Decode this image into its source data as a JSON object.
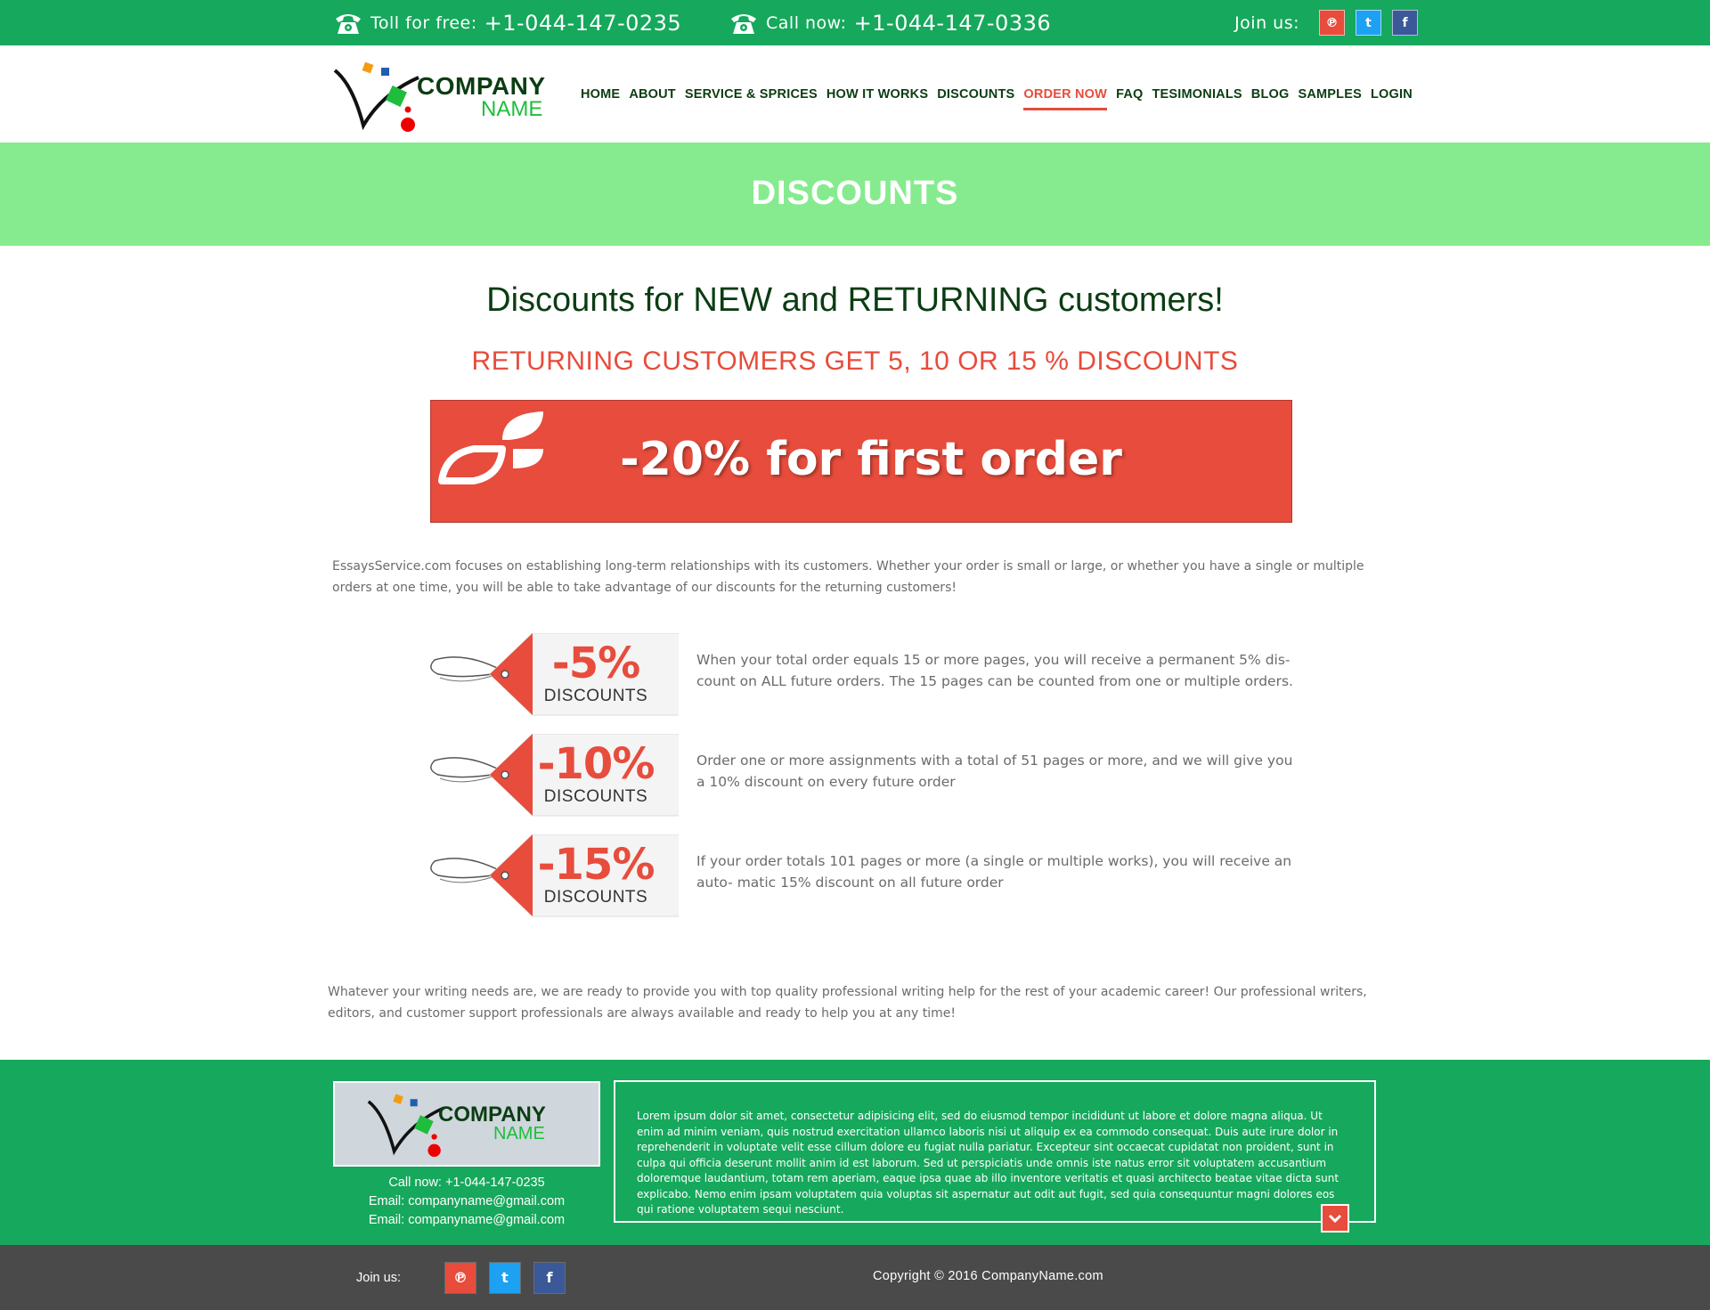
{
  "topbar": {
    "tollfree_label": "Toll for free:",
    "tollfree_number": "+1-044-147-0235",
    "callnow_label": "Call now:",
    "callnow_number": "+1-044-147-0336",
    "join_label": "Join us:",
    "social": [
      {
        "name": "pinterest-icon",
        "glyph": "℗",
        "color": "#e74c3c"
      },
      {
        "name": "twitter-icon",
        "glyph": "t",
        "color": "#1da1f2"
      },
      {
        "name": "facebook-icon",
        "glyph": "f",
        "color": "#3b5998"
      }
    ]
  },
  "logo": {
    "line1": "COMPANY",
    "line2": "NAME"
  },
  "nav": {
    "items": [
      {
        "label": "HOME"
      },
      {
        "label": "ABOUT"
      },
      {
        "label": "SERVICE & SPRICES"
      },
      {
        "label": "HOW IT WORKS"
      },
      {
        "label": "DISCOUNTS"
      },
      {
        "label": "ORDER NOW",
        "active": true
      },
      {
        "label": "FAQ"
      },
      {
        "label": "TESIMONIALS"
      },
      {
        "label": "BLOG"
      },
      {
        "label": "SAMPLES"
      },
      {
        "label": "LOGIN"
      }
    ]
  },
  "banner": {
    "title": "DISCOUNTS"
  },
  "main": {
    "heading": "Discounts for NEW and RETURNING customers!",
    "subheading": "RETURNING CUSTOMERS GET 5, 10 OR 15 % DISCOUNTS",
    "promo": "-20% for first order",
    "intro": "EssaysService.com focuses on establishing long-term relationships with its customers.  Whether your order is small or large, or whether you have a single or multiple orders at one time, you will be able to take advantage of our discounts for the returning customers!",
    "discounts": [
      {
        "percent": "-5%",
        "label": "DISCOUNTS",
        "text": "When your total order equals 15 or more pages, you will receive a permanent 5% dis- count on ALL future orders. The 15 pages can be counted from one or multiple orders."
      },
      {
        "percent": "-10%",
        "label": "DISCOUNTS",
        "text": "Order one or more assignments with a total of 51 pages or more, and we will give you a 10% discount on every future order"
      },
      {
        "percent": "-15%",
        "label": "DISCOUNTS",
        "text": "If your order totals 101 pages or more (a single or multiple works), you will receive an auto- matic 15% discount on all future order"
      }
    ],
    "outro": "Whatever your writing needs are, we are ready to provide you with top quality professional writing help for the rest of your academic career!  Our professional writers, editors, and customer support professionals are always available and ready to help you at any time!"
  },
  "footer": {
    "logo": {
      "line1": "COMPANY",
      "line2": "NAME"
    },
    "call": "Call now: +1-044-147-0235",
    "email1": "Email: companyname@gmail.com",
    "email2": "Email: companyname@gmail.com",
    "lorem": "Lorem ipsum dolor sit amet, consectetur adipisicing elit, sed do eiusmod tempor incididunt ut labore et dolore magna aliqua. Ut enim ad minim veniam, quis nostrud exercitation ullamco laboris nisi ut aliquip ex ea commodo consequat. Duis aute irure dolor in reprehenderit in voluptate velit esse cillum dolore eu fugiat nulla pariatur. Excepteur sint occaecat cupidatat non proident, sunt in culpa qui officia deserunt mollit anim id est laborum. Sed ut perspiciatis unde omnis iste natus error sit voluptatem accusantium doloremque laudantium, totam rem aperiam, eaque ipsa quae ab illo inventore veritatis et quasi architecto beatae vitae dicta sunt explicabo. Nemo enim ipsam voluptatem quia voluptas sit aspernatur aut odit aut fugit, sed quia consequuntur magni dolores eos qui ratione voluptatem sequi nesciunt."
  },
  "bottombar": {
    "join_label": "Join us:",
    "copyright": "Copyright © 2016 CompanyName.com"
  },
  "colors": {
    "green": "#16a85c",
    "light_green": "#86eb8f",
    "red": "#e74c3c",
    "dark_green": "#0b3d12",
    "dark_gray": "#4a4a4a"
  }
}
